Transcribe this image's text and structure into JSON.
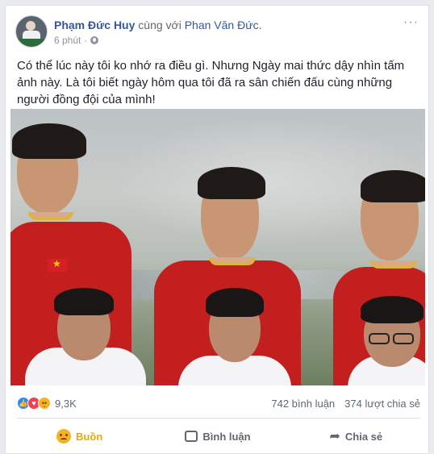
{
  "post": {
    "author": "Phạm Đức Huy",
    "with_text": "cùng với",
    "tagged": "Phan Văn Đức.",
    "time": "6 phút",
    "dot": "·",
    "more": "···",
    "content": "Có thể lúc này tôi ko nhớ ra điều gì. Nhưng Ngày mai thức dậy nhìn tấm ảnh này. Là tôi biết ngày hôm qua tôi đã ra sân chiến đấu cùng những người đồng đội của mình!"
  },
  "stats": {
    "reactions_count": "9,3K",
    "comments": "742 bình luận",
    "shares": "374 lượt chia sẻ",
    "reaction_icons": [
      "like-icon",
      "love-icon",
      "sad-icon"
    ]
  },
  "actions": {
    "react_label": "Buồn",
    "comment_label": "Bình luận",
    "share_label": "Chia sẻ"
  },
  "colors": {
    "link": "#365899",
    "reaction_active": "#e9a900",
    "jersey": "#c41f1f"
  }
}
